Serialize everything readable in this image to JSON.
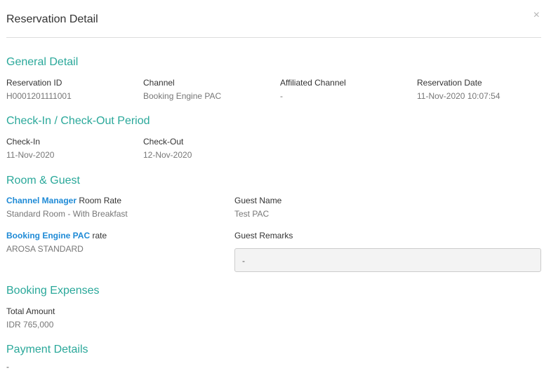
{
  "header": {
    "title": "Reservation Detail",
    "close_glyph": "×"
  },
  "general_detail": {
    "title": "General Detail",
    "reservation_id": {
      "label": "Reservation ID",
      "value": "H0001201111001"
    },
    "channel": {
      "label": "Channel",
      "value": "Booking Engine PAC"
    },
    "affiliated_channel": {
      "label": "Affiliated Channel",
      "value": "-"
    },
    "reservation_date": {
      "label": "Reservation Date",
      "value": "11-Nov-2020 10:07:54"
    }
  },
  "period": {
    "title": "Check-In / Check-Out Period",
    "check_in": {
      "label": "Check-In",
      "value": "11-Nov-2020"
    },
    "check_out": {
      "label": "Check-Out",
      "value": "12-Nov-2020"
    }
  },
  "room_guest": {
    "title": "Room & Guest",
    "cm_rate": {
      "highlight": "Channel Manager",
      "suffix": " Room Rate",
      "value": "Standard Room - With Breakfast"
    },
    "guest_name": {
      "label": "Guest Name",
      "value": "Test PAC"
    },
    "be_rate": {
      "highlight": "Booking Engine PAC",
      "suffix": " rate",
      "value": "AROSA STANDARD"
    },
    "guest_remarks": {
      "label": "Guest Remarks",
      "value": "-"
    }
  },
  "expenses": {
    "title": "Booking Expenses",
    "total_amount": {
      "label": "Total Amount",
      "value": "IDR 765,000"
    }
  },
  "payment": {
    "title": "Payment Details",
    "value": "-"
  },
  "colors": {
    "accent": "#2aa89a",
    "link": "#1e8ad6",
    "label": "#333333",
    "value": "#777777"
  }
}
